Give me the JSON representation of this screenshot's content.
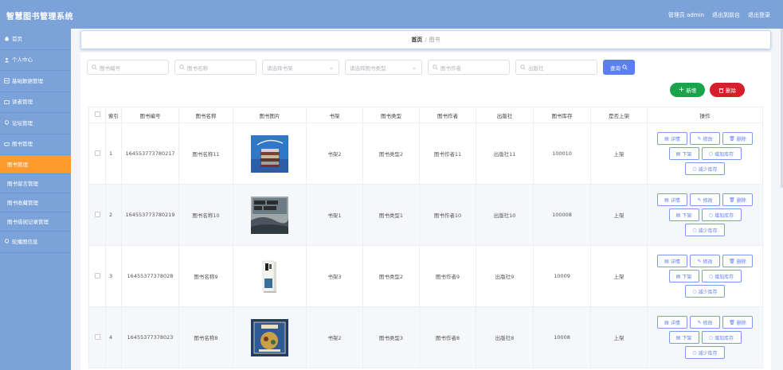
{
  "app": {
    "title": "智慧图书管理系统",
    "admin_label": "管理员 admin",
    "to_front": "退出到前台",
    "logout": "退出登录"
  },
  "sidebar": {
    "items": [
      {
        "label": "首页",
        "icon": "home-icon"
      },
      {
        "label": "个人中心",
        "icon": "user-icon"
      },
      {
        "label": "基础数据管理",
        "icon": "grid-icon"
      },
      {
        "label": "读者管理",
        "icon": "card-icon"
      },
      {
        "label": "论坛管理",
        "icon": "bulb-icon"
      },
      {
        "label": "图书管理",
        "icon": "chat-icon"
      }
    ],
    "sub_items": [
      {
        "label": "图书管理",
        "active": true
      },
      {
        "label": "图书留言管理",
        "active": false
      },
      {
        "label": "图书收藏管理",
        "active": false
      },
      {
        "label": "图书借阅记录管理",
        "active": false
      }
    ],
    "last_item": {
      "label": "轮播图信息",
      "icon": "bulb-icon"
    },
    "active_color": "#ff9a2e",
    "bg_color": "#7ca3d9"
  },
  "breadcrumb": {
    "home": "首页",
    "separator": "/",
    "current": "图书"
  },
  "filters": {
    "book_no": "图书编号",
    "book_name": "图书名称",
    "shelf": "请选择书架",
    "book_type": "请选择图书类型",
    "author": "图书作者",
    "publisher": "出版社",
    "search_label": "查询"
  },
  "actions": {
    "add_label": "新增",
    "delete_label": "删除"
  },
  "table": {
    "headers": [
      "",
      "索引",
      "图书编号",
      "图书名称",
      "图书图片",
      "书架",
      "图书类型",
      "图书作者",
      "出版社",
      "图书库存",
      "是否上架",
      "操作"
    ],
    "row_ops": {
      "detail": "详情",
      "edit": "修改",
      "delete": "删除",
      "off_shelf": "下架",
      "add_stock": "增加库存",
      "reduce_stock": "减少库存"
    },
    "rows": [
      {
        "index": "1",
        "book_no": "164553773780217",
        "name": "图书名称11",
        "shelf": "书架2",
        "type": "图书类型2",
        "author": "图书作者11",
        "publisher": "出版社11",
        "stock": "100010",
        "status": "上架",
        "cover": "books-stack"
      },
      {
        "index": "2",
        "book_no": "164553773780219",
        "name": "图书名称10",
        "shelf": "书架1",
        "type": "图书类型1",
        "author": "图书作者10",
        "publisher": "出版社10",
        "stock": "100008",
        "status": "上架",
        "cover": "landscape-poster"
      },
      {
        "index": "3",
        "book_no": "16455377378028",
        "name": "图书名称9",
        "shelf": "书架3",
        "type": "图书类型2",
        "author": "图书作者9",
        "publisher": "出版社9",
        "stock": "10009",
        "status": "上架",
        "cover": "standing-book"
      },
      {
        "index": "4",
        "book_no": "16455377378023",
        "name": "图书名称8",
        "shelf": "书架2",
        "type": "图书类型3",
        "author": "图书作者8",
        "publisher": "出版社8",
        "stock": "10008",
        "status": "上架",
        "cover": "blue-cover"
      }
    ]
  }
}
